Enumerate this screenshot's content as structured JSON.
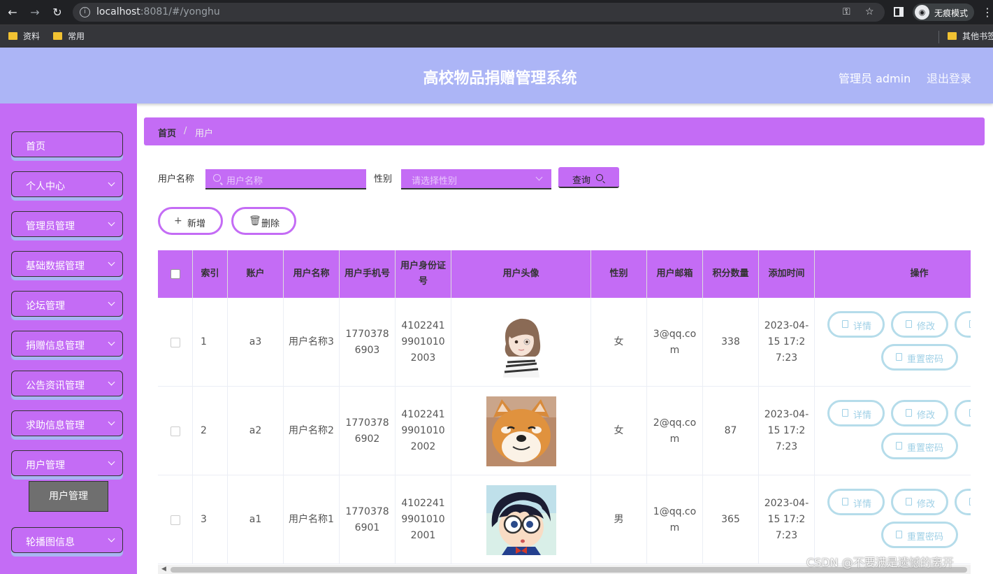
{
  "browser": {
    "url_host": "localhost",
    "url_rest": ":8081/#/yonghu",
    "incognito_label": "无痕模式",
    "bookmarks": [
      "资料",
      "常用"
    ],
    "other_bookmarks": "其他书签"
  },
  "header": {
    "title": "高校物品捐赠管理系统",
    "admin": "管理员 admin",
    "logout": "退出登录"
  },
  "sidebar": {
    "items": [
      {
        "label": "首页",
        "has_arrow": false
      },
      {
        "label": "个人中心",
        "has_arrow": true
      },
      {
        "label": "管理员管理",
        "has_arrow": true
      },
      {
        "label": "基础数据管理",
        "has_arrow": true
      },
      {
        "label": "论坛管理",
        "has_arrow": true
      },
      {
        "label": "捐赠信息管理",
        "has_arrow": true
      },
      {
        "label": "公告资讯管理",
        "has_arrow": true
      },
      {
        "label": "求助信息管理",
        "has_arrow": true
      },
      {
        "label": "用户管理",
        "has_arrow": true
      },
      {
        "label": "轮播图信息",
        "has_arrow": true
      }
    ],
    "submenu": "用户管理"
  },
  "breadcrumb": {
    "home": "首页",
    "sep": "/",
    "current": "用户"
  },
  "filters": {
    "username_label": "用户名称",
    "username_placeholder": "用户名称",
    "gender_label": "性别",
    "gender_placeholder": "请选择性别",
    "query_label": "查询"
  },
  "actions": {
    "add": "新增",
    "delete": "删除"
  },
  "table": {
    "headers": [
      "索引",
      "账户",
      "用户名称",
      "用户手机号",
      "用户身份证号",
      "用户头像",
      "性别",
      "用户邮箱",
      "积分数量",
      "添加时间",
      "操作"
    ],
    "rows": [
      {
        "index": "1",
        "account": "a3",
        "name": "用户名称3",
        "phone": "17703786903",
        "id_card": "410224199010102003",
        "avatar": "girl",
        "gender": "女",
        "email": "3@qq.com",
        "points": "338",
        "time": "2023-04-15 17:27:23"
      },
      {
        "index": "2",
        "account": "a2",
        "name": "用户名称2",
        "phone": "17703786902",
        "id_card": "410224199010102002",
        "avatar": "dog",
        "gender": "女",
        "email": "2@qq.com",
        "points": "87",
        "time": "2023-04-15 17:27:23"
      },
      {
        "index": "3",
        "account": "a1",
        "name": "用户名称1",
        "phone": "17703786901",
        "id_card": "410224199010102001",
        "avatar": "boy",
        "gender": "男",
        "email": "1@qq.com",
        "points": "365",
        "time": "2023-04-15 17:27:23"
      }
    ],
    "op_labels": {
      "detail": "详情",
      "edit": "修改",
      "reset": "重置密码"
    }
  },
  "watermark": "CSDN @不要满是遗憾的离开"
}
